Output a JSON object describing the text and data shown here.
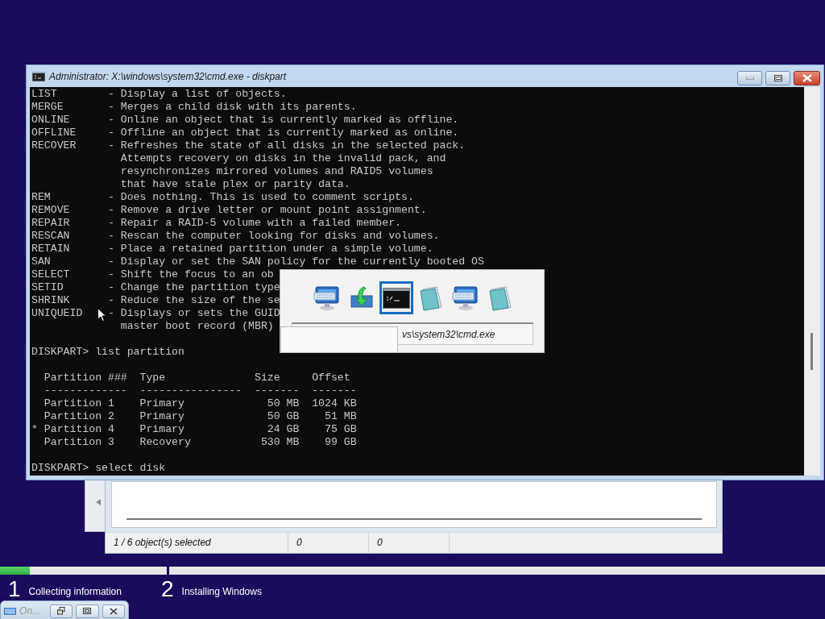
{
  "console_window": {
    "title": "Administrator: X:\\windows\\system32\\cmd.exe - diskpart",
    "output": "LIST        - Display a list of objects.\nMERGE       - Merges a child disk with its parents.\nONLINE      - Online an object that is currently marked as offline.\nOFFLINE     - Offline an object that is currently marked as online.\nRECOVER     - Refreshes the state of all disks in the selected pack.\n              Attempts recovery on disks in the invalid pack, and\n              resynchronizes mirrored volumes and RAID5 volumes\n              that have stale plex or parity data.\nREM         - Does nothing. This is used to comment scripts.\nREMOVE      - Remove a drive letter or mount point assignment.\nREPAIR      - Repair a RAID-5 volume with a failed member.\nRESCAN      - Rescan the computer looking for disks and volumes.\nRETAIN      - Place a retained partition under a simple volume.\nSAN         - Display or set the SAN policy for the currently booted OS\nSELECT      - Shift the focus to an ob\nSETID       - Change the partition type\nSHRINK      - Reduce the size of the se\nUNIQUEID    - Displays or sets the GUID\n              master boot record (MBR)\n\nDISKPART> list partition\n\n  Partition ###  Type              Size     Offset\n  -------------  ----------------  -------  -------\n  Partition 1    Primary             50 MB  1024 KB\n  Partition 2    Primary             50 GB    51 MB\n* Partition 4    Primary             24 GB    75 GB\n  Partition 3    Recovery           530 MB    99 GB\n\nDISKPART> select disk"
  },
  "task_switcher": {
    "items": [
      {
        "kind": "computer",
        "selected": false
      },
      {
        "kind": "setup",
        "selected": false
      },
      {
        "kind": "console",
        "selected": true
      },
      {
        "kind": "notepad",
        "selected": false
      },
      {
        "kind": "computer",
        "selected": false
      },
      {
        "kind": "notepad",
        "selected": false
      }
    ],
    "path": "vs\\system32\\cmd.exe"
  },
  "setup_window": {
    "status": [
      "1 / 6 object(s) selected",
      "0",
      "0"
    ]
  },
  "steps": [
    {
      "number": "1",
      "label": "Collecting information",
      "level": 0.18
    },
    {
      "number": "2",
      "label": "Installing Windows"
    }
  ],
  "keyboard_window": {
    "title": "On..."
  }
}
